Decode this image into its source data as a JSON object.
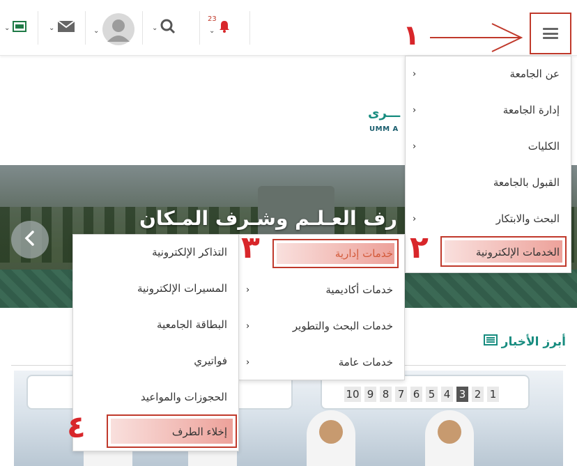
{
  "topbar": {
    "notification_count": "23",
    "icons": [
      "menu-icon",
      "bell-icon",
      "search-icon",
      "avatar",
      "mail-icon",
      "screen-icon"
    ]
  },
  "logo": {
    "arabic_fragment": "ـــرى",
    "english_fragment": "UMM A"
  },
  "banner": {
    "caption": "رف العـلـم وشـرف المـكان"
  },
  "main_menu": {
    "items": [
      {
        "label": "عن الجامعة",
        "has_sub": true
      },
      {
        "label": "إدارة الجامعة",
        "has_sub": true
      },
      {
        "label": "الكليات",
        "has_sub": true
      },
      {
        "label": "القبول بالجامعة",
        "has_sub": false
      },
      {
        "label": "البحث والابتكار",
        "has_sub": true
      },
      {
        "label": "الخدمات الإلكترونية",
        "has_sub": false
      }
    ]
  },
  "sub_menu": {
    "items": [
      {
        "label": "خدمات إدارية"
      },
      {
        "label": "خدمات أكاديمية"
      },
      {
        "label": "خدمات البحث والتطوير"
      },
      {
        "label": "خدمات عامة"
      }
    ]
  },
  "third_menu": {
    "items": [
      {
        "label": "التذاكر الإلكترونية"
      },
      {
        "label": "المسيرات الإلكترونية"
      },
      {
        "label": "البطاقة الجامعية"
      },
      {
        "label": "فواتيري"
      },
      {
        "label": "الحجوزات والمواعيد"
      },
      {
        "label": "إخلاء الطرف"
      }
    ]
  },
  "news": {
    "title": "أبرز الأخبار",
    "pages": [
      "1",
      "2",
      "3",
      "4",
      "5",
      "6",
      "7",
      "8",
      "9",
      "10"
    ],
    "active_page": "3"
  },
  "annotations": {
    "step1": "١",
    "step2": "٢",
    "step3": "٣",
    "step4": "٤"
  },
  "colors": {
    "accent": "#178c7f",
    "annotation": "#c0392b",
    "notification": "#d8262a"
  }
}
